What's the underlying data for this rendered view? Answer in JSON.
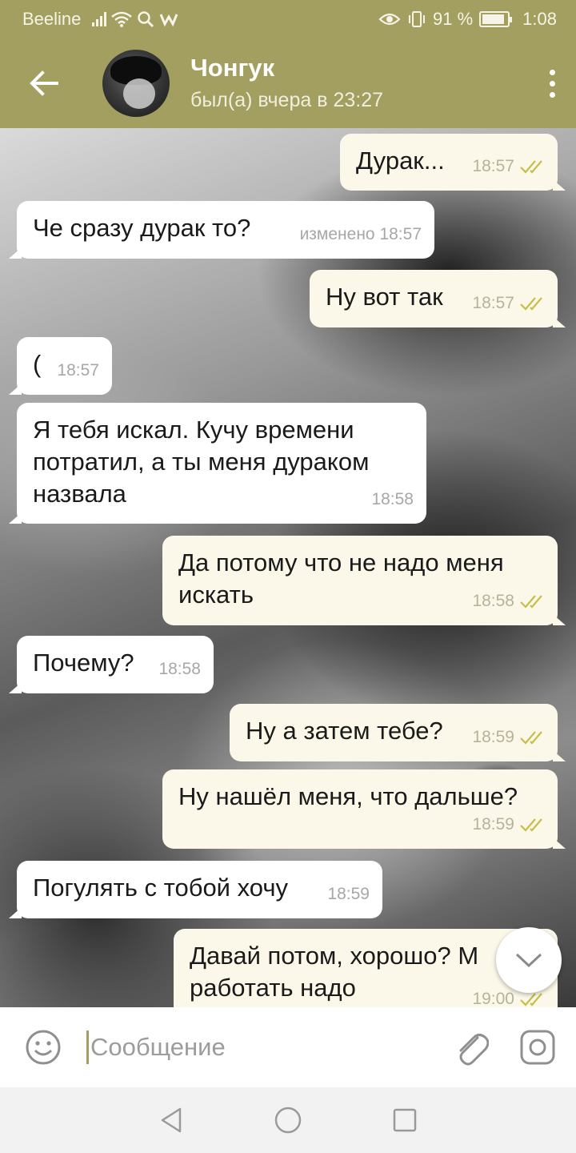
{
  "status_bar": {
    "carrier": "Beeline",
    "battery_percent": "91 %",
    "time": "1:08",
    "battery_level": 0.91
  },
  "header": {
    "contact_name": "Чонгук",
    "contact_status": "был(а) вчера в 23:27",
    "back_icon": "arrow-left-icon",
    "menu_icon": "more-vert-icon"
  },
  "messages": [
    {
      "dir": "out",
      "text": "Дурак...",
      "time": "18:57",
      "read": true
    },
    {
      "dir": "in",
      "text": "Че сразу дурак то?",
      "time": "изменено 18:57"
    },
    {
      "dir": "out",
      "text": "Ну вот так",
      "time": "18:57",
      "read": true
    },
    {
      "dir": "in",
      "text": "(",
      "time": "18:57"
    },
    {
      "dir": "in",
      "text": "Я тебя искал. Кучу времени\nпотратил, а ты меня дураком\nназвала",
      "time": "18:58"
    },
    {
      "dir": "out",
      "text": "Да потому что не надо меня\nискать",
      "time": "18:58",
      "read": true
    },
    {
      "dir": "in",
      "text": "Почему?",
      "time": "18:58"
    },
    {
      "dir": "out",
      "text": "Ну а затем тебе?",
      "time": "18:59",
      "read": true
    },
    {
      "dir": "out",
      "text": "Ну нашёл меня, что дальше?",
      "time": "18:59",
      "read": true
    },
    {
      "dir": "in",
      "text": "Погулять с тобой хочу",
      "time": "18:59"
    },
    {
      "dir": "out",
      "text": "Давай потом, хорошо? М\nработать надо",
      "time": "19:00",
      "read": true
    }
  ],
  "input": {
    "placeholder": "Сообщение"
  },
  "colors": {
    "header_bg": "#a39f61",
    "out_bubble": "#fbf8e9",
    "in_bubble": "#ffffff",
    "check_color": "#c9bd4a"
  }
}
